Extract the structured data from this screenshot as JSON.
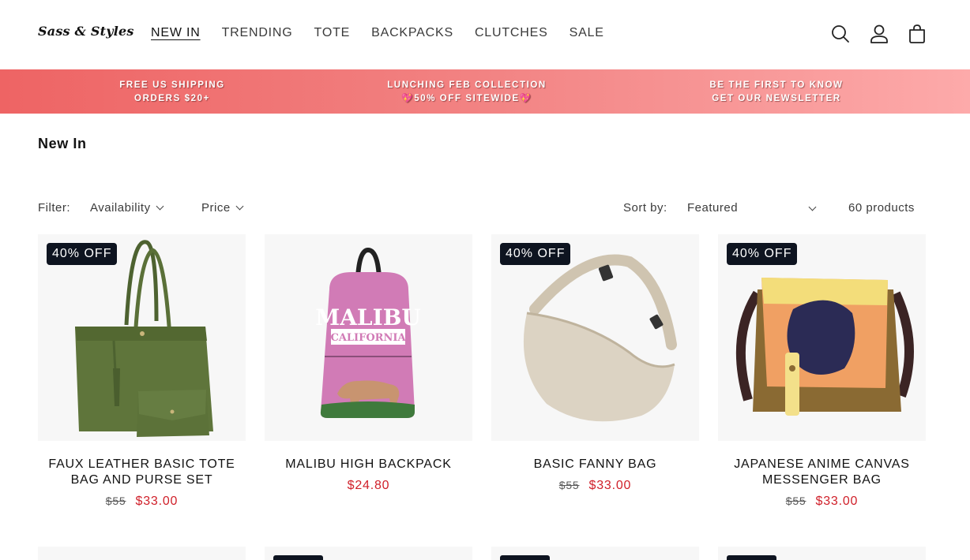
{
  "brand": {
    "logo_text": "Sass & Styles"
  },
  "nav": {
    "items": [
      "NEW IN",
      "TRENDING",
      "TOTE",
      "BACKPACKS",
      "CLUTCHES",
      "SALE"
    ],
    "active": "NEW IN"
  },
  "header_icons": [
    "search-icon",
    "account-icon",
    "cart-icon"
  ],
  "announcement": [
    {
      "line1": "FREE US SHIPPING",
      "line2": "ORDERS $20+"
    },
    {
      "line1": "LUNCHING FEB COLLECTION",
      "line2": "💖50% OFF SITEWIDE💖"
    },
    {
      "line1": "BE THE FIRST TO KNOW",
      "line2": "GET OUR NEWSLETTER"
    }
  ],
  "page": {
    "title": "New In"
  },
  "filters": {
    "label": "Filter:",
    "availability": "Availability",
    "price": "Price",
    "sort_label": "Sort by:",
    "sort_value": "Featured",
    "count": "60 products"
  },
  "products": [
    {
      "title": "FAUX LEATHER BASIC TOTE BAG AND PURSE SET",
      "badge": "40% OFF",
      "old_price": "$55",
      "price": "$33.00"
    },
    {
      "title": "MALIBU HIGH BACKPACK",
      "badge": "",
      "old_price": "",
      "price": "$24.80",
      "print_line1": "MALIBU",
      "print_line2": "CALIFORNIA"
    },
    {
      "title": "BASIC FANNY BAG",
      "badge": "40% OFF",
      "old_price": "$55",
      "price": "$33.00"
    },
    {
      "title": "JAPANESE ANIME CANVAS MESSENGER BAG",
      "badge": "40% OFF",
      "old_price": "$55",
      "price": "$33.00"
    }
  ],
  "colors": {
    "accent_red": "#d0202a",
    "badge_bg": "#0e1420",
    "banner_start": "#ee6464",
    "banner_end": "#fdaaaa"
  }
}
